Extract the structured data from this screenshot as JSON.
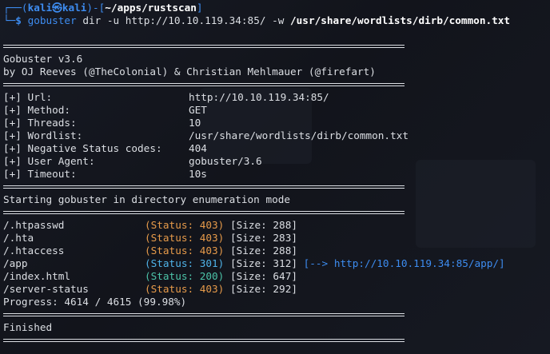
{
  "prompt": {
    "corner_top": "┌──(",
    "user": "kali",
    "at": "㉿",
    "host": "kali",
    "mid": ")-[",
    "path": "~/apps/rustscan",
    "end": "]",
    "corner_bottom": "└─",
    "symbol": "$"
  },
  "command": {
    "program": "gobuster",
    "args_plain": "dir -u http://10.10.119.34:85/",
    "flag_w": "-w",
    "wordlist": "/usr/share/wordlists/dirb/common.txt"
  },
  "banner": {
    "title": "Gobuster v3.6",
    "authors": "by OJ Reeves (@TheColonial) & Christian Mehlmauer (@firefart)"
  },
  "config": [
    {
      "key": "[+] Url:",
      "value": "http://10.10.119.34:85/"
    },
    {
      "key": "[+] Method:",
      "value": "GET"
    },
    {
      "key": "[+] Threads:",
      "value": "10"
    },
    {
      "key": "[+] Wordlist:",
      "value": "/usr/share/wordlists/dirb/common.txt"
    },
    {
      "key": "[+] Negative Status codes:",
      "value": "404"
    },
    {
      "key": "[+] User Agent:",
      "value": "gobuster/3.6"
    },
    {
      "key": "[+] Timeout:",
      "value": "10s"
    }
  ],
  "start_message": "Starting gobuster in directory enumeration mode",
  "results": [
    {
      "path": "/.htpasswd",
      "status": "(Status: 403)",
      "size": "[Size: 288]",
      "redirect": ""
    },
    {
      "path": "/.hta",
      "status": "(Status: 403)",
      "size": "[Size: 283]",
      "redirect": ""
    },
    {
      "path": "/.htaccess",
      "status": "(Status: 403)",
      "size": "[Size: 288]",
      "redirect": ""
    },
    {
      "path": "/app",
      "status": "(Status: 301)",
      "size": "[Size: 312]",
      "redirect": "[--> http://10.10.119.34:85/app/]"
    },
    {
      "path": "/index.html",
      "status": "(Status: 200)",
      "size": "[Size: 647]",
      "redirect": ""
    },
    {
      "path": "/server-status",
      "status": "(Status: 403)",
      "size": "[Size: 292]",
      "redirect": ""
    }
  ],
  "progress": "Progress: 4614 / 4615 (99.98%)",
  "finished": "Finished",
  "colors": {
    "prompt_blue": "#3d8cf0",
    "status_403": "#e69a4a",
    "status_301": "#4fb3e8",
    "status_200": "#4cc3a8",
    "text": "#dcdfe4",
    "background": "#13151d"
  }
}
